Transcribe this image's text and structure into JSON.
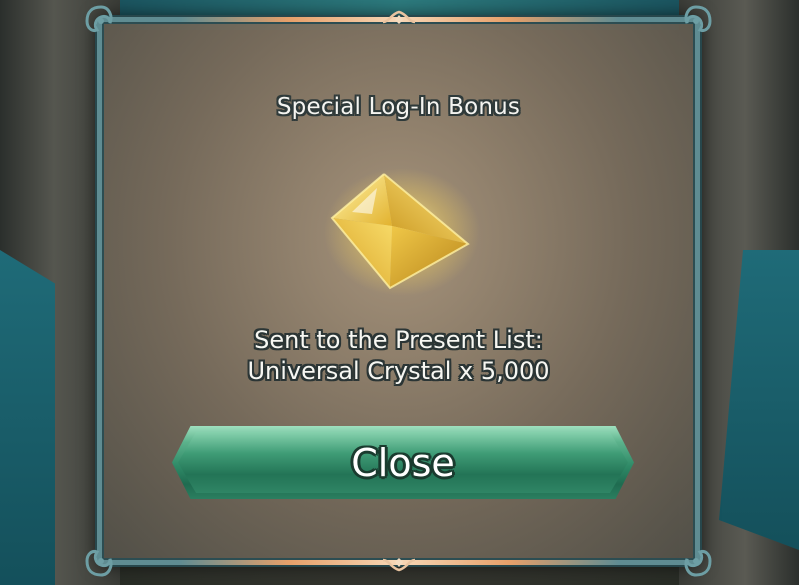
{
  "dialog": {
    "title": "Special Log-In Bonus",
    "message_line1": "Sent to the Present List:",
    "message_line2": "Universal Crystal x 5,000",
    "close_label": "Close",
    "reward_icon": "universal-crystal-icon"
  },
  "colors": {
    "frame": "#5f8c92",
    "accent_bar": "#e6a06a",
    "button_green": "#2f8a67",
    "crystal_gold": "#f2cf4a"
  }
}
